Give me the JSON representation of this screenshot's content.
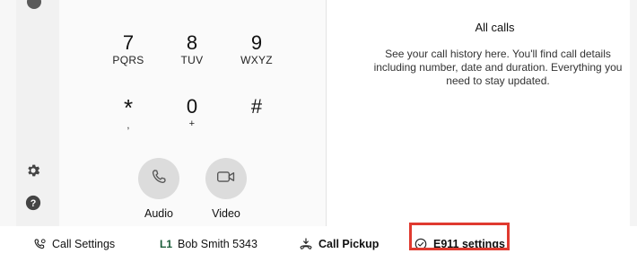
{
  "dialpad": {
    "keys": [
      {
        "digit": "7",
        "letters": "PQRS"
      },
      {
        "digit": "8",
        "letters": "TUV"
      },
      {
        "digit": "9",
        "letters": "WXYZ"
      },
      {
        "digit": "*",
        "letters": ","
      },
      {
        "digit": "0",
        "letters": "+"
      },
      {
        "digit": "#",
        "letters": ""
      }
    ],
    "audio_label": "Audio",
    "video_label": "Video"
  },
  "history": {
    "title": "All calls",
    "description": "See your call history here. You'll find call details including number, date and duration. Everything you need to stay updated."
  },
  "footer": {
    "call_settings": "Call Settings",
    "line_tag": "L1",
    "line_name": "Bob Smith 5343",
    "call_pickup": "Call Pickup",
    "e911_settings": "E911 settings"
  },
  "icons": {
    "settings": "gear-icon",
    "help": "help-icon",
    "phone": "phone-icon",
    "video": "video-camera-icon",
    "call_settings": "phone-settings-icon",
    "call_pickup": "call-pickup-icon",
    "e911": "check-circle-icon"
  },
  "colors": {
    "highlight": "#e03a2f",
    "line_tag": "#1b5d3a",
    "call_button_bg": "#dcdcdc"
  }
}
